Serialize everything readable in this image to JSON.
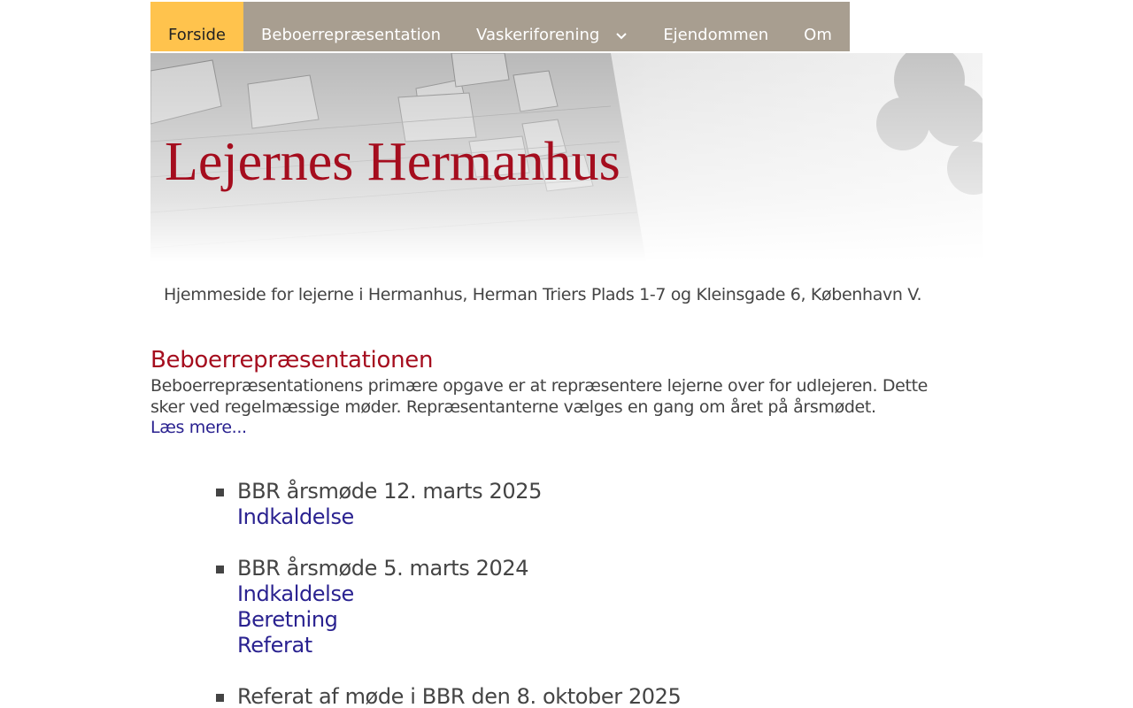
{
  "nav": {
    "items": [
      {
        "label": "Forside"
      },
      {
        "label": "Beboerrepræsentation"
      },
      {
        "label": "Vaskeriforening"
      },
      {
        "label": "Ejendommen"
      },
      {
        "label": "Om"
      }
    ],
    "active_color": "#ffc34d",
    "bar_color": "#a89e90"
  },
  "header": {
    "title": "Lejernes Hermanhus",
    "title_color": "#a50d1e"
  },
  "intro": {
    "tagline": "Hjemmeside for lejerne i Hermanhus, Herman Triers Plads 1-7 og Kleinsgade 6, København V."
  },
  "section": {
    "heading": "Beboerrepræsentationen",
    "text": "Beboerrepræsentationens primære opgave er at repræsentere lejerne over for udlejeren. Dette sker ved regelmæssige møder. Repræsentanterne vælges en gang om året på årsmødet.",
    "read_more": "Læs mere..."
  },
  "events": [
    {
      "title": "BBR årsmøde 12. marts 2025",
      "links": [
        "Indkaldelse"
      ]
    },
    {
      "title": "BBR årsmøde 5. marts 2024",
      "links": [
        "Indkaldelse",
        "Beretning",
        "Referat"
      ]
    },
    {
      "title": "Referat af møde i BBR den 8. oktober 2025",
      "links": []
    }
  ],
  "link_color": "#2a2290"
}
